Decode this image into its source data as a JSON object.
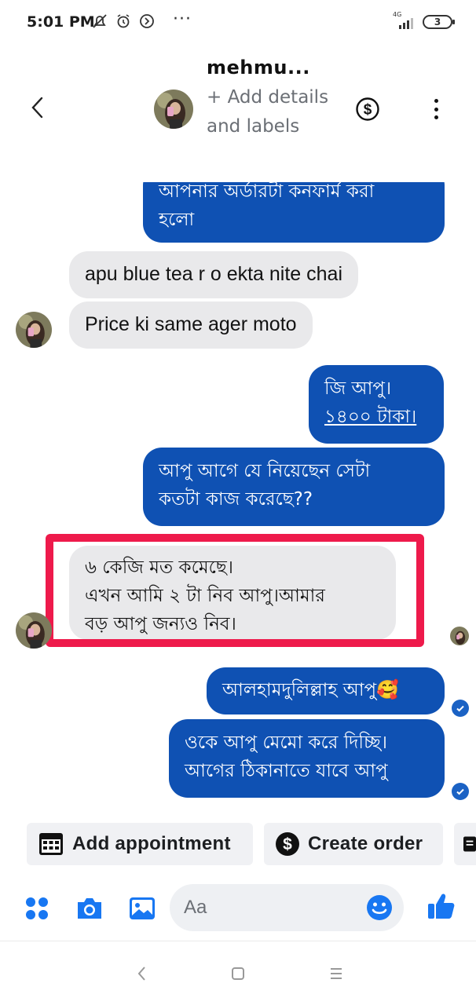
{
  "status_bar": {
    "time": "5:01 PM",
    "icons": [
      "notifications-off-icon",
      "alarm-icon",
      "dnd-icon"
    ],
    "more": "···",
    "network": "4G",
    "battery": "3"
  },
  "header": {
    "contact_name": "mehmu...",
    "add_details": "+ Add details and labels",
    "accent": "#0f51b3"
  },
  "messages": [
    {
      "dir": "out",
      "lines": [
        "আপনার অর্ডারটা কনফার্ম করা",
        "হলো"
      ]
    },
    {
      "dir": "in",
      "lines": [
        "apu blue tea r o ekta nite chai"
      ]
    },
    {
      "dir": "in",
      "lines": [
        "Price ki same ager moto"
      ]
    },
    {
      "dir": "out",
      "lines": [
        "জি আপু।",
        "১৪০০ টাকা।"
      ]
    },
    {
      "dir": "out",
      "lines": [
        "আপু  আগে যে নিয়েছেন সেটা",
        "কতটা কাজ করেছে??"
      ]
    },
    {
      "dir": "in",
      "lines": [
        "৬ কেজি মত কমেছে।",
        "এখন আমি ২ টা নিব আপু।আমার",
        "বড় আপু জন্যও নিব।"
      ]
    },
    {
      "dir": "out",
      "lines": [
        "আলহামদুলিল্লাহ আপু🥰"
      ]
    },
    {
      "dir": "out",
      "lines": [
        "ওকে আপু মেমো করে দিচ্ছি।",
        "আগের ঠিকানাতে যাবে আপু"
      ]
    }
  ],
  "quick_actions": {
    "add_appointment": "Add appointment",
    "create_order": "Create order"
  },
  "composer": {
    "placeholder": "Aa"
  },
  "colors": {
    "outgoing_bubble": "#0f51b3",
    "incoming_bubble": "#e9e9eb",
    "highlight": "#ee1a4b",
    "icon_blue": "#1877f2"
  }
}
